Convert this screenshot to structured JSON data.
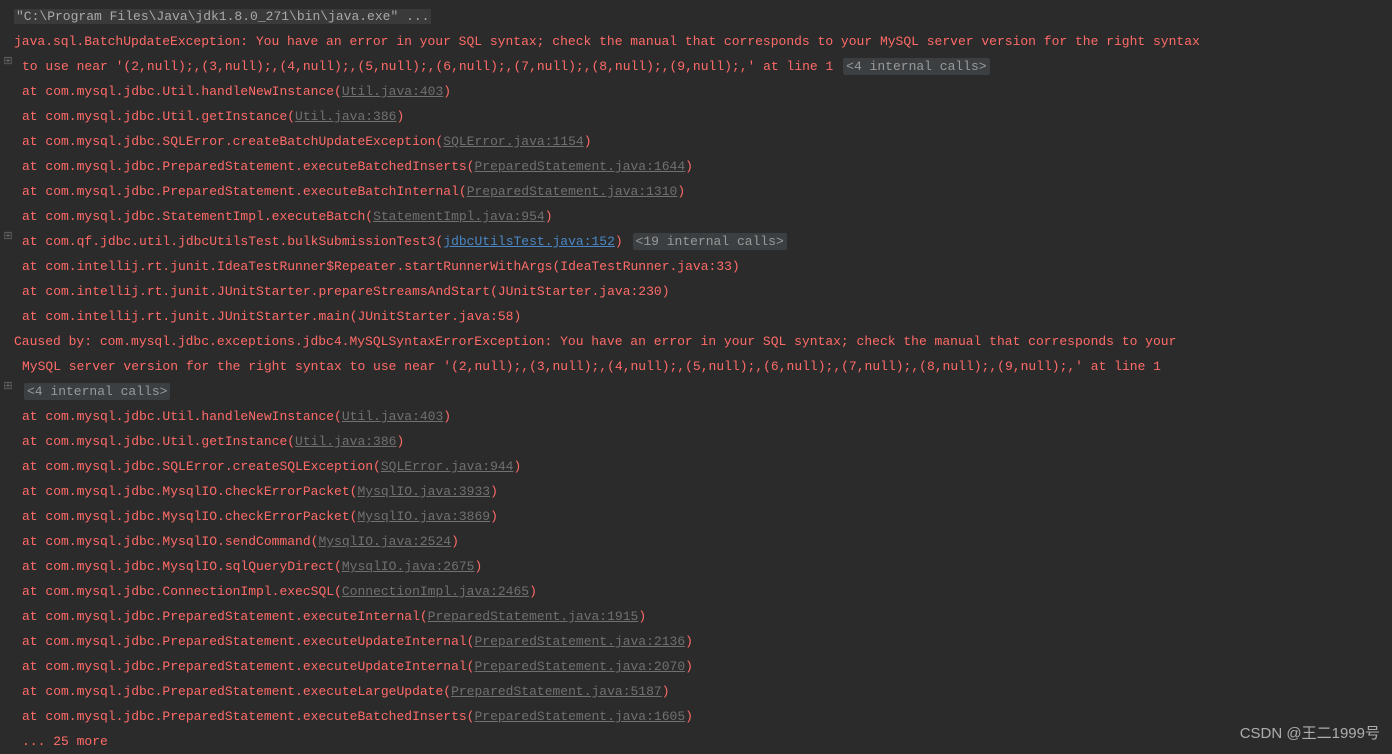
{
  "cmd": "\"C:\\Program Files\\Java\\jdk1.8.0_271\\bin\\java.exe\" ...",
  "ex1_main": "java.sql.BatchUpdateException: You have an error in your SQL syntax; check the manual that corresponds to your MySQL server version for the right syntax",
  "ex1_cont": " to use near '(2,null);,(3,null);,(4,null);,(5,null);,(6,null);,(7,null);,(8,null);,(9,null);,' at line 1",
  "fold_a": "<4 internal calls>",
  "stack1": [
    {
      "pre": "    at com.mysql.jdbc.Util.handleNewInstance(",
      "link": "Util.java:403",
      "post": ")"
    },
    {
      "pre": "    at com.mysql.jdbc.Util.getInstance(",
      "link": "Util.java:386",
      "post": ")"
    },
    {
      "pre": "    at com.mysql.jdbc.SQLError.createBatchUpdateException(",
      "link": "SQLError.java:1154",
      "post": ")"
    },
    {
      "pre": "    at com.mysql.jdbc.PreparedStatement.executeBatchedInserts(",
      "link": "PreparedStatement.java:1644",
      "post": ")"
    },
    {
      "pre": "    at com.mysql.jdbc.PreparedStatement.executeBatchInternal(",
      "link": "PreparedStatement.java:1310",
      "post": ")"
    },
    {
      "pre": "    at com.mysql.jdbc.StatementImpl.executeBatch(",
      "link": "StatementImpl.java:954",
      "post": ")"
    }
  ],
  "usercall_pre": "    at com.qf.jdbc.util.jdbcUtilsTest.bulkSubmissionTest3(",
  "usercall_link": "jdbcUtilsTest.java:152",
  "usercall_post": ")",
  "fold_b": "<19 internal calls>",
  "intellij": [
    "    at com.intellij.rt.junit.IdeaTestRunner$Repeater.startRunnerWithArgs(IdeaTestRunner.java:33)",
    "    at com.intellij.rt.junit.JUnitStarter.prepareStreamsAndStart(JUnitStarter.java:230)",
    "    at com.intellij.rt.junit.JUnitStarter.main(JUnitStarter.java:58)"
  ],
  "caused_a": "Caused by: com.mysql.jdbc.exceptions.jdbc4.MySQLSyntaxErrorException: You have an error in your SQL syntax; check the manual that corresponds to your",
  "caused_b": " MySQL server version for the right syntax to use near '(2,null);,(3,null);,(4,null);,(5,null);,(6,null);,(7,null);,(8,null);,(9,null);,' at line 1",
  "fold_c": "<4 internal calls>",
  "stack2": [
    {
      "pre": "    at com.mysql.jdbc.Util.handleNewInstance(",
      "link": "Util.java:403",
      "post": ")"
    },
    {
      "pre": "    at com.mysql.jdbc.Util.getInstance(",
      "link": "Util.java:386",
      "post": ")"
    },
    {
      "pre": "    at com.mysql.jdbc.SQLError.createSQLException(",
      "link": "SQLError.java:944",
      "post": ")"
    },
    {
      "pre": "    at com.mysql.jdbc.MysqlIO.checkErrorPacket(",
      "link": "MysqlIO.java:3933",
      "post": ")"
    },
    {
      "pre": "    at com.mysql.jdbc.MysqlIO.checkErrorPacket(",
      "link": "MysqlIO.java:3869",
      "post": ")"
    },
    {
      "pre": "    at com.mysql.jdbc.MysqlIO.sendCommand(",
      "link": "MysqlIO.java:2524",
      "post": ")"
    },
    {
      "pre": "    at com.mysql.jdbc.MysqlIO.sqlQueryDirect(",
      "link": "MysqlIO.java:2675",
      "post": ")"
    },
    {
      "pre": "    at com.mysql.jdbc.ConnectionImpl.execSQL(",
      "link": "ConnectionImpl.java:2465",
      "post": ")"
    },
    {
      "pre": "    at com.mysql.jdbc.PreparedStatement.executeInternal(",
      "link": "PreparedStatement.java:1915",
      "post": ")"
    },
    {
      "pre": "    at com.mysql.jdbc.PreparedStatement.executeUpdateInternal(",
      "link": "PreparedStatement.java:2136",
      "post": ")"
    },
    {
      "pre": "    at com.mysql.jdbc.PreparedStatement.executeUpdateInternal(",
      "link": "PreparedStatement.java:2070",
      "post": ")"
    },
    {
      "pre": "    at com.mysql.jdbc.PreparedStatement.executeLargeUpdate(",
      "link": "PreparedStatement.java:5187",
      "post": ")"
    },
    {
      "pre": "    at com.mysql.jdbc.PreparedStatement.executeBatchedInserts(",
      "link": "PreparedStatement.java:1605",
      "post": ")"
    }
  ],
  "more": "    ... 25 more",
  "watermark": "CSDN @王二1999号",
  "expand_glyph": "⊞"
}
